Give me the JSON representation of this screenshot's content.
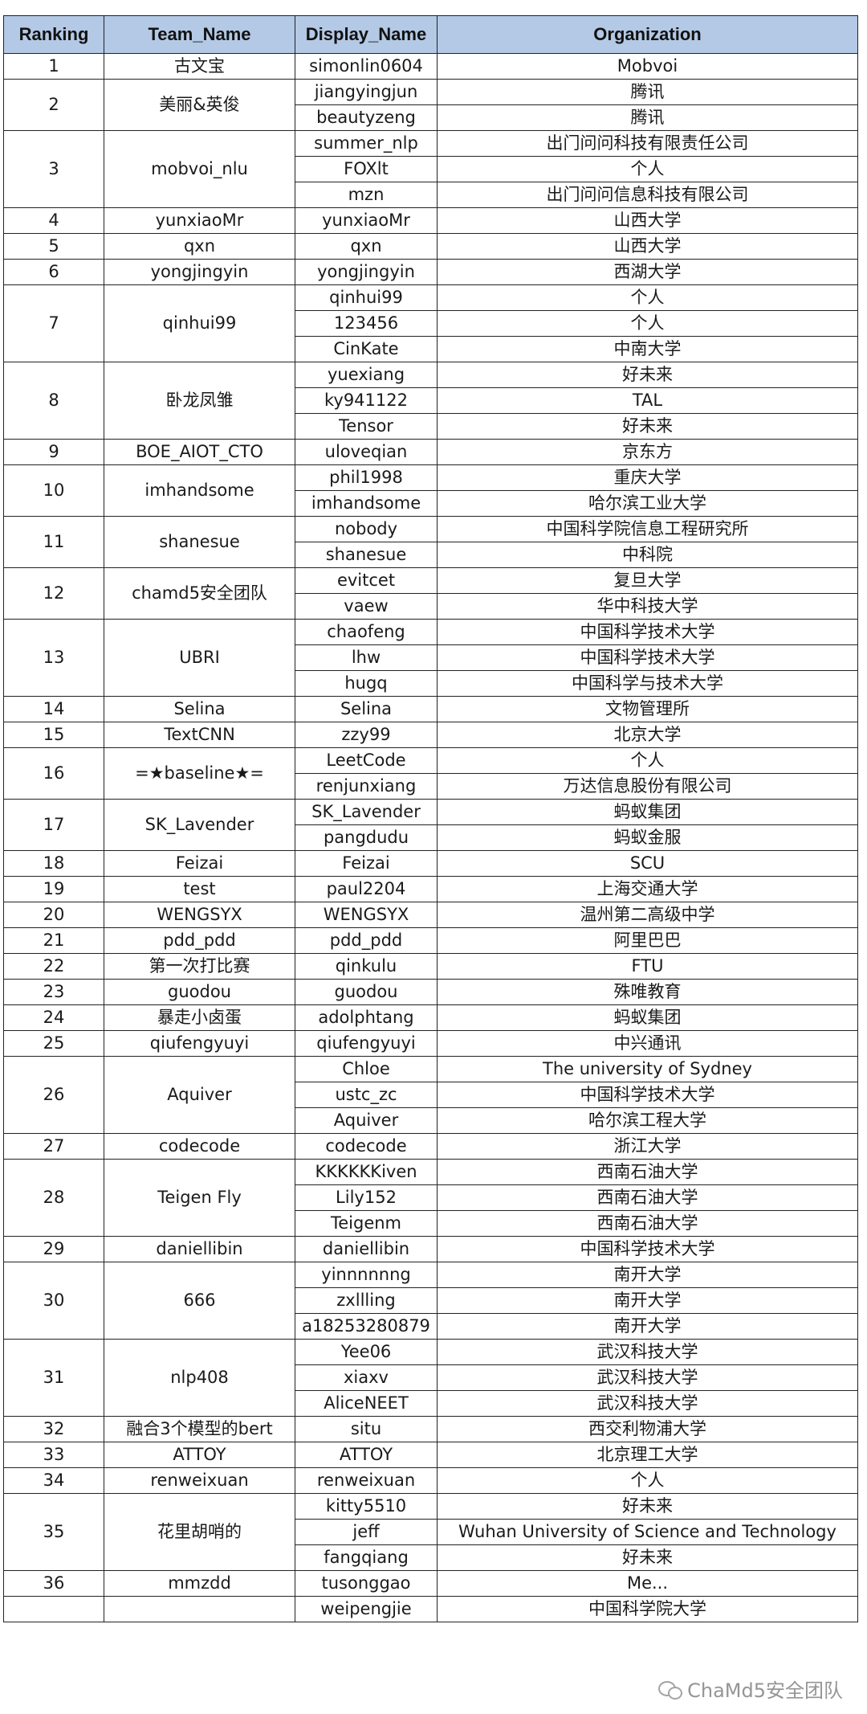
{
  "headers": {
    "ranking": "Ranking",
    "team_name": "Team_Name",
    "display_name": "Display_Name",
    "organization": "Organization"
  },
  "teams": [
    {
      "rank": "1",
      "team": "古文宝",
      "members": [
        [
          "simonlin0604",
          "Mobvoi"
        ]
      ]
    },
    {
      "rank": "2",
      "team": "美丽&英俊",
      "members": [
        [
          "jiangyingjun",
          "腾讯"
        ],
        [
          "beautyzeng",
          "腾讯"
        ]
      ]
    },
    {
      "rank": "3",
      "team": "mobvoi_nlu",
      "members": [
        [
          "summer_nlp",
          "出门问问科技有限责任公司"
        ],
        [
          "FOXlt",
          "个人"
        ],
        [
          "mzn",
          "出门问问信息科技有限公司"
        ]
      ]
    },
    {
      "rank": "4",
      "team": "yunxiaoMr",
      "members": [
        [
          "yunxiaoMr",
          "山西大学"
        ]
      ]
    },
    {
      "rank": "5",
      "team": "qxn",
      "members": [
        [
          "qxn",
          "山西大学"
        ]
      ]
    },
    {
      "rank": "6",
      "team": "yongjingyin",
      "members": [
        [
          "yongjingyin",
          "西湖大学"
        ]
      ]
    },
    {
      "rank": "7",
      "team": "qinhui99",
      "members": [
        [
          "qinhui99",
          "个人"
        ],
        [
          "123456",
          "个人"
        ],
        [
          "CinKate",
          "中南大学"
        ]
      ]
    },
    {
      "rank": "8",
      "team": "卧龙凤雏",
      "members": [
        [
          "yuexiang",
          "好未来"
        ],
        [
          "ky941122",
          "TAL"
        ],
        [
          "Tensor",
          "好未来"
        ]
      ]
    },
    {
      "rank": "9",
      "team": "BOE_AIOT_CTO",
      "members": [
        [
          "uloveqian",
          "京东方"
        ]
      ]
    },
    {
      "rank": "10",
      "team": "imhandsome",
      "members": [
        [
          "phil1998",
          "重庆大学"
        ],
        [
          "imhandsome",
          "哈尔滨工业大学"
        ]
      ]
    },
    {
      "rank": "11",
      "team": "shanesue",
      "members": [
        [
          "nobody",
          "中国科学院信息工程研究所"
        ],
        [
          "shanesue",
          "中科院"
        ]
      ]
    },
    {
      "rank": "12",
      "team": "chamd5安全团队",
      "members": [
        [
          "evitcet",
          "复旦大学"
        ],
        [
          "vaew",
          "华中科技大学"
        ]
      ]
    },
    {
      "rank": "13",
      "team": "UBRI",
      "members": [
        [
          "chaofeng",
          "中国科学技术大学"
        ],
        [
          "lhw",
          "中国科学技术大学"
        ],
        [
          "hugq",
          "中国科学与技术大学"
        ]
      ]
    },
    {
      "rank": "14",
      "team": "Selina",
      "members": [
        [
          "Selina",
          "文物管理所"
        ]
      ]
    },
    {
      "rank": "15",
      "team": "TextCNN",
      "members": [
        [
          "zzy99",
          "北京大学"
        ]
      ]
    },
    {
      "rank": "16",
      "team": "=★baseline★=",
      "members": [
        [
          "LeetCode",
          "个人"
        ],
        [
          "renjunxiang",
          "万达信息股份有限公司"
        ]
      ]
    },
    {
      "rank": "17",
      "team": "SK_Lavender",
      "members": [
        [
          "SK_Lavender",
          "蚂蚁集团"
        ],
        [
          "pangdudu",
          "蚂蚁金服"
        ]
      ]
    },
    {
      "rank": "18",
      "team": "Feizai",
      "members": [
        [
          "Feizai",
          "SCU"
        ]
      ]
    },
    {
      "rank": "19",
      "team": "test",
      "members": [
        [
          "paul2204",
          "上海交通大学"
        ]
      ]
    },
    {
      "rank": "20",
      "team": "WENGSYX",
      "members": [
        [
          "WENGSYX",
          "温州第二高级中学"
        ]
      ]
    },
    {
      "rank": "21",
      "team": "pdd_pdd",
      "members": [
        [
          "pdd_pdd",
          "阿里巴巴"
        ]
      ]
    },
    {
      "rank": "22",
      "team": "第一次打比赛",
      "members": [
        [
          "qinkulu",
          "FTU"
        ]
      ]
    },
    {
      "rank": "23",
      "team": "guodou",
      "members": [
        [
          "guodou",
          "殊唯教育"
        ]
      ]
    },
    {
      "rank": "24",
      "team": "暴走小卤蛋",
      "members": [
        [
          "adolphtang",
          "蚂蚁集团"
        ]
      ]
    },
    {
      "rank": "25",
      "team": "qiufengyuyi",
      "members": [
        [
          "qiufengyuyi",
          "中兴通讯"
        ]
      ]
    },
    {
      "rank": "26",
      "team": "Aquiver",
      "members": [
        [
          "Chloe",
          "The university of Sydney"
        ],
        [
          "ustc_zc",
          "中国科学技术大学"
        ],
        [
          "Aquiver",
          "哈尔滨工程大学"
        ]
      ]
    },
    {
      "rank": "27",
      "team": "codecode",
      "members": [
        [
          "codecode",
          "浙江大学"
        ]
      ]
    },
    {
      "rank": "28",
      "team": "Teigen Fly",
      "members": [
        [
          "KKKKKKiven",
          "西南石油大学"
        ],
        [
          "Lily152",
          "西南石油大学"
        ],
        [
          "Teigenm",
          "西南石油大学"
        ]
      ]
    },
    {
      "rank": "29",
      "team": "daniellibin",
      "members": [
        [
          "daniellibin",
          "中国科学技术大学"
        ]
      ]
    },
    {
      "rank": "30",
      "team": "666",
      "members": [
        [
          "yinnnnnng",
          "南开大学"
        ],
        [
          "zxllling",
          "南开大学"
        ],
        [
          "a18253280879",
          "南开大学"
        ]
      ]
    },
    {
      "rank": "31",
      "team": "nlp408",
      "members": [
        [
          "Yee06",
          "武汉科技大学"
        ],
        [
          "xiaxv",
          "武汉科技大学"
        ],
        [
          "AliceNEET",
          "武汉科技大学"
        ]
      ]
    },
    {
      "rank": "32",
      "team": "融合3个模型的bert",
      "members": [
        [
          "situ",
          "西交利物浦大学"
        ]
      ]
    },
    {
      "rank": "33",
      "team": "ATTOY",
      "members": [
        [
          "ATTOY",
          "北京理工大学"
        ]
      ]
    },
    {
      "rank": "34",
      "team": "renweixuan",
      "members": [
        [
          "renweixuan",
          "个人"
        ]
      ]
    },
    {
      "rank": "35",
      "team": "花里胡哨的",
      "members": [
        [
          "kitty5510",
          "好未来"
        ],
        [
          "jeff",
          "Wuhan University of Science and Technology"
        ],
        [
          "fangqiang",
          "好未来"
        ]
      ]
    },
    {
      "rank": "36",
      "team": "mmzdd",
      "members": [
        [
          "tusonggao",
          "Me..."
        ]
      ]
    },
    {
      "rank": "",
      "team": "",
      "members": [
        [
          "weipengjie",
          "中国科学院大学"
        ]
      ]
    }
  ],
  "watermark": {
    "text": "ChaMd5安全团队",
    "icon": "wechat-icon"
  }
}
